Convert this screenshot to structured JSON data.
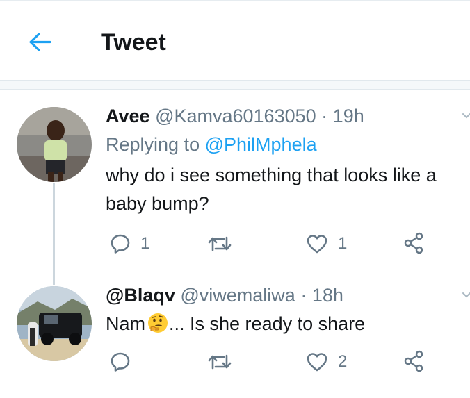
{
  "header": {
    "title": "Tweet",
    "back_icon": "arrow-left-icon",
    "accent": "#1da1f2"
  },
  "tweets": [
    {
      "display_name": "Avee",
      "handle": "@Kamva60163050",
      "separator": "·",
      "time": "19h",
      "replying_label": "Replying to",
      "replying_to": "@PhilMphela",
      "text": "why do i see something that looks like a baby bump?",
      "reply_count": "1",
      "retweet_count": "",
      "like_count": "1"
    },
    {
      "display_name": "@Blaqv",
      "handle": "@viwemaliwa",
      "separator": "·",
      "time": "18h",
      "text_before_emoji": "Nam",
      "emoji": "thinking-face-emoji",
      "text_after_emoji": "... Is she ready to share",
      "reply_count": "",
      "retweet_count": "",
      "like_count": "2"
    }
  ],
  "colors": {
    "text": "#14171a",
    "muted": "#657786",
    "border": "#e1e8ed",
    "link": "#1da1f2"
  }
}
